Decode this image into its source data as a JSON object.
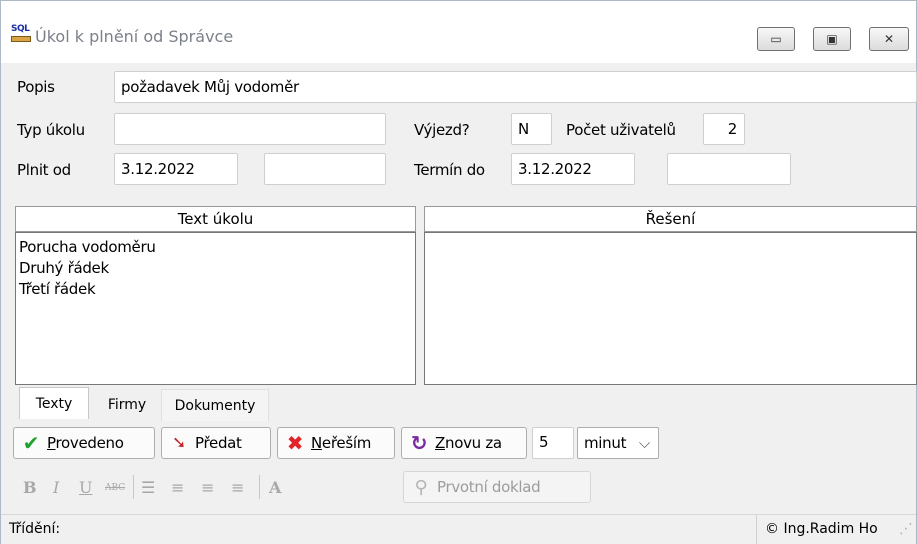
{
  "window": {
    "title": "Úkol k plnění od Správce",
    "logo_text": "SQL",
    "controls": {
      "minimize": "▭",
      "maximize": "▣",
      "close": "✕"
    }
  },
  "form": {
    "popis_label": "Popis",
    "popis_value": "požadavek Můj vodoměr",
    "typ_label": "Typ úkolu",
    "typ_value": "",
    "vyjezd_label": "Výjezd?",
    "vyjezd_value": "N",
    "pocet_label": "Počet uživatelů",
    "pocet_value": "2",
    "plnit_label": "Plnit od",
    "plnit_value": "3.12.2022",
    "plnit_extra": "",
    "termin_label": "Termín do",
    "termin_value": "3.12.2022",
    "termin_extra": ""
  },
  "memos": {
    "text_header": "Text úkolu",
    "text_lines": [
      "Porucha vodoměru",
      "Druhý řádek",
      "Třetí řádek"
    ],
    "reseni_header": "Řešení"
  },
  "tabs": [
    {
      "label": "Texty",
      "active": true
    },
    {
      "label": "Firmy",
      "active": false
    },
    {
      "label": "Dokumenty",
      "active": false
    }
  ],
  "actions": {
    "provedeno": "Provedeno",
    "predat": "Předat",
    "neresim": "Neřeším",
    "znovu": "Znovu za",
    "interval_value": "5",
    "unit_selected": "minut"
  },
  "format_toolbar": {
    "bold": "B",
    "italic": "I",
    "underline": "U",
    "strike": "ABC",
    "font": "A",
    "prvotni": "Prvotní doklad"
  },
  "status": {
    "sort_label": "Třídění:",
    "copyright": "© Ing.Radim Ho"
  },
  "colors": {
    "check_green": "#1fa32c",
    "cross_red": "#e2232a",
    "refresh_purple": "#7a2aa0",
    "title_gray": "#7b8089"
  }
}
